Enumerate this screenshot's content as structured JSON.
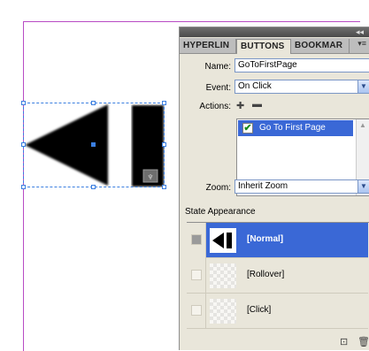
{
  "panel": {
    "collapse_glyph": "◂◂",
    "tabs": [
      {
        "label": "HYPERLIN",
        "active": false
      },
      {
        "label": "BUTTONS",
        "active": true
      },
      {
        "label": "BOOKMAR",
        "active": false
      }
    ],
    "menu_glyph": "▾≡",
    "name_label": "Name:",
    "name_value": "GoToFirstPage",
    "event_label": "Event:",
    "event_value": "On Click",
    "actions_label": "Actions:",
    "add_action_icon": "plus-icon",
    "remove_action_icon": "minus-icon",
    "actions": [
      {
        "label": "Go To First Page",
        "checked": true
      }
    ],
    "zoom_label": "Zoom:",
    "zoom_value": "Inherit Zoom",
    "state_section_label": "State Appearance",
    "states": [
      {
        "label": "[Normal]",
        "selected": true
      },
      {
        "label": "[Rollover]",
        "selected": false
      },
      {
        "label": "[Click]",
        "selected": false
      }
    ]
  },
  "colors": {
    "selection": "#3a68d6",
    "frame_guide": "#b84cc4",
    "panel_bg": "#e9e6da"
  }
}
